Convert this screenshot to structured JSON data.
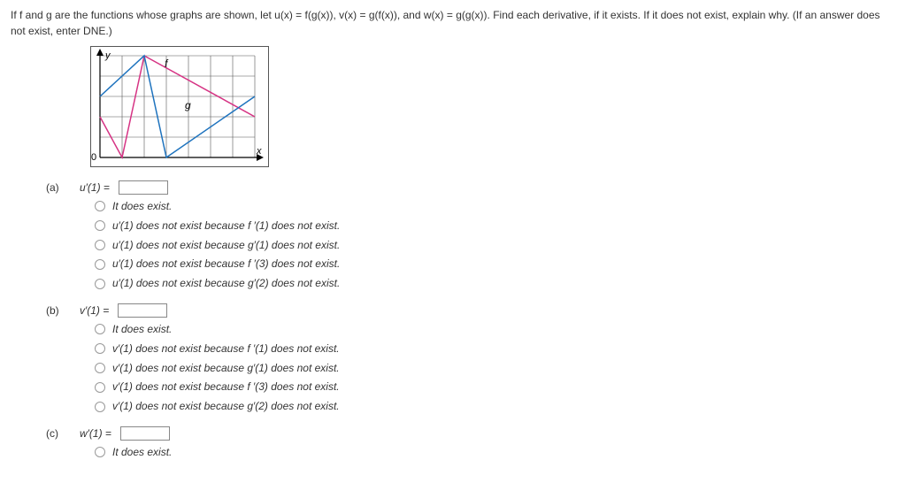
{
  "intro": "If f and g are the functions whose graphs are shown, let  u(x) = f(g(x)),  v(x) = g(f(x)), and w(x) = g(g(x)).  Find each derivative, if it exists. If it does not exist, explain why. (If an answer does not exist, enter DNE.)",
  "graph": {
    "labels": {
      "y": "y",
      "x": "x",
      "origin": "0",
      "f": "f",
      "g": "g"
    }
  },
  "parts": [
    {
      "label": "(a)",
      "eqn": "u′(1) =",
      "options": [
        "It does exist.",
        "u′(1) does not exist because f ′(1) does not exist.",
        "u′(1) does not exist because g′(1) does not exist.",
        "u′(1) does not exist because f ′(3) does not exist.",
        "u′(1) does not exist because g′(2) does not exist."
      ]
    },
    {
      "label": "(b)",
      "eqn": "v′(1) =",
      "options": [
        "It does exist.",
        "v′(1) does not exist because f ′(1) does not exist.",
        "v′(1) does not exist because g′(1) does not exist.",
        "v′(1) does not exist because f ′(3) does not exist.",
        "v′(1) does not exist because g′(2) does not exist."
      ]
    },
    {
      "label": "(c)",
      "eqn": "w′(1) =",
      "options": [
        "It does exist."
      ]
    }
  ]
}
